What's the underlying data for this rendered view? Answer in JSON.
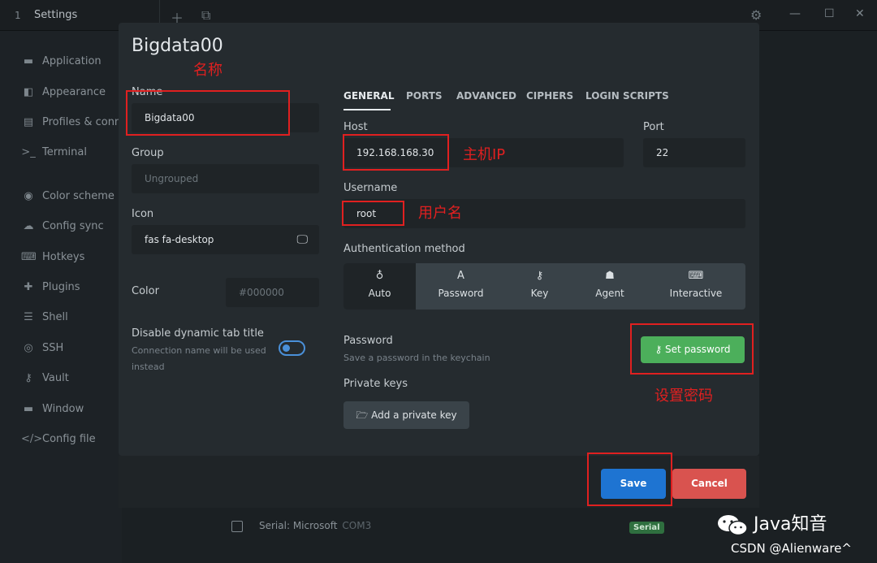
{
  "titlebar": {
    "tab_number": "1",
    "tab_title": "Settings",
    "new_tab_icon": "plus-icon",
    "window_icon": "window-icon",
    "settings_icon": "gear-icon"
  },
  "sidebar": {
    "items": [
      {
        "label": "Application",
        "icon": "▬"
      },
      {
        "label": "Appearance",
        "icon": "◧"
      },
      {
        "label": "Profiles & connections",
        "icon": "▤"
      },
      {
        "label": "Terminal",
        "icon": ">_"
      },
      {
        "label": "Color scheme",
        "icon": "◉"
      },
      {
        "label": "Config sync",
        "icon": "☁"
      },
      {
        "label": "Hotkeys",
        "icon": "⌨"
      },
      {
        "label": "Plugins",
        "icon": "✚"
      },
      {
        "label": "Shell",
        "icon": "☰"
      },
      {
        "label": "SSH",
        "icon": "◎"
      },
      {
        "label": "Vault",
        "icon": "⚷"
      },
      {
        "label": "Window",
        "icon": "▬"
      },
      {
        "label": "Config file",
        "icon": "</>"
      }
    ]
  },
  "background": {
    "serial_row_label": "Serial: Microsoft",
    "serial_row_port": "COM3",
    "serial_badge": "Serial"
  },
  "modal": {
    "title": "Bigdata00",
    "name_label": "Name",
    "name_value": "Bigdata00",
    "group_label": "Group",
    "group_placeholder": "Ungrouped",
    "icon_label": "Icon",
    "icon_value": "fas fa-desktop",
    "color_label": "Color",
    "color_placeholder": "#000000",
    "dynamic_title_label": "Disable dynamic tab title",
    "dynamic_title_sub1": "Connection name will be used",
    "dynamic_title_sub2": "instead",
    "dynamic_title_enabled": false,
    "tabs": [
      "GENERAL",
      "PORTS",
      "ADVANCED",
      "CIPHERS",
      "LOGIN SCRIPTS"
    ],
    "active_tab": "GENERAL",
    "host_label": "Host",
    "host_value": "192.168.168.30",
    "port_label": "Port",
    "port_value": "22",
    "username_label": "Username",
    "username_value": "root",
    "auth_label": "Authentication method",
    "auth_options": [
      {
        "label": "Auto",
        "icon": "bulb-icon",
        "glyph": "♁"
      },
      {
        "label": "Password",
        "icon": "password-icon",
        "glyph": "A"
      },
      {
        "label": "Key",
        "icon": "key-icon",
        "glyph": "⚷"
      },
      {
        "label": "Agent",
        "icon": "agent-icon",
        "glyph": "☗"
      },
      {
        "label": "Interactive",
        "icon": "keyboard-icon",
        "glyph": "⌨"
      }
    ],
    "active_auth": "Auto",
    "password_label": "Password",
    "password_sub": "Save a password in the keychain",
    "set_password_button": "Set password",
    "private_keys_label": "Private keys",
    "add_key_button": "Add a private key",
    "save_button": "Save",
    "cancel_button": "Cancel"
  },
  "annotations": {
    "name_note": "名称",
    "host_note": "主机IP",
    "username_note": "用户名",
    "password_note": "设置密码",
    "color": "#e02020"
  },
  "watermark": {
    "brand": "Java知音",
    "credit": "CSDN @Alienware^"
  },
  "colors": {
    "accent_blue": "#1e74d2",
    "green": "#4caf5b",
    "red": "#d9534f",
    "modal_bg": "#252b2f"
  }
}
